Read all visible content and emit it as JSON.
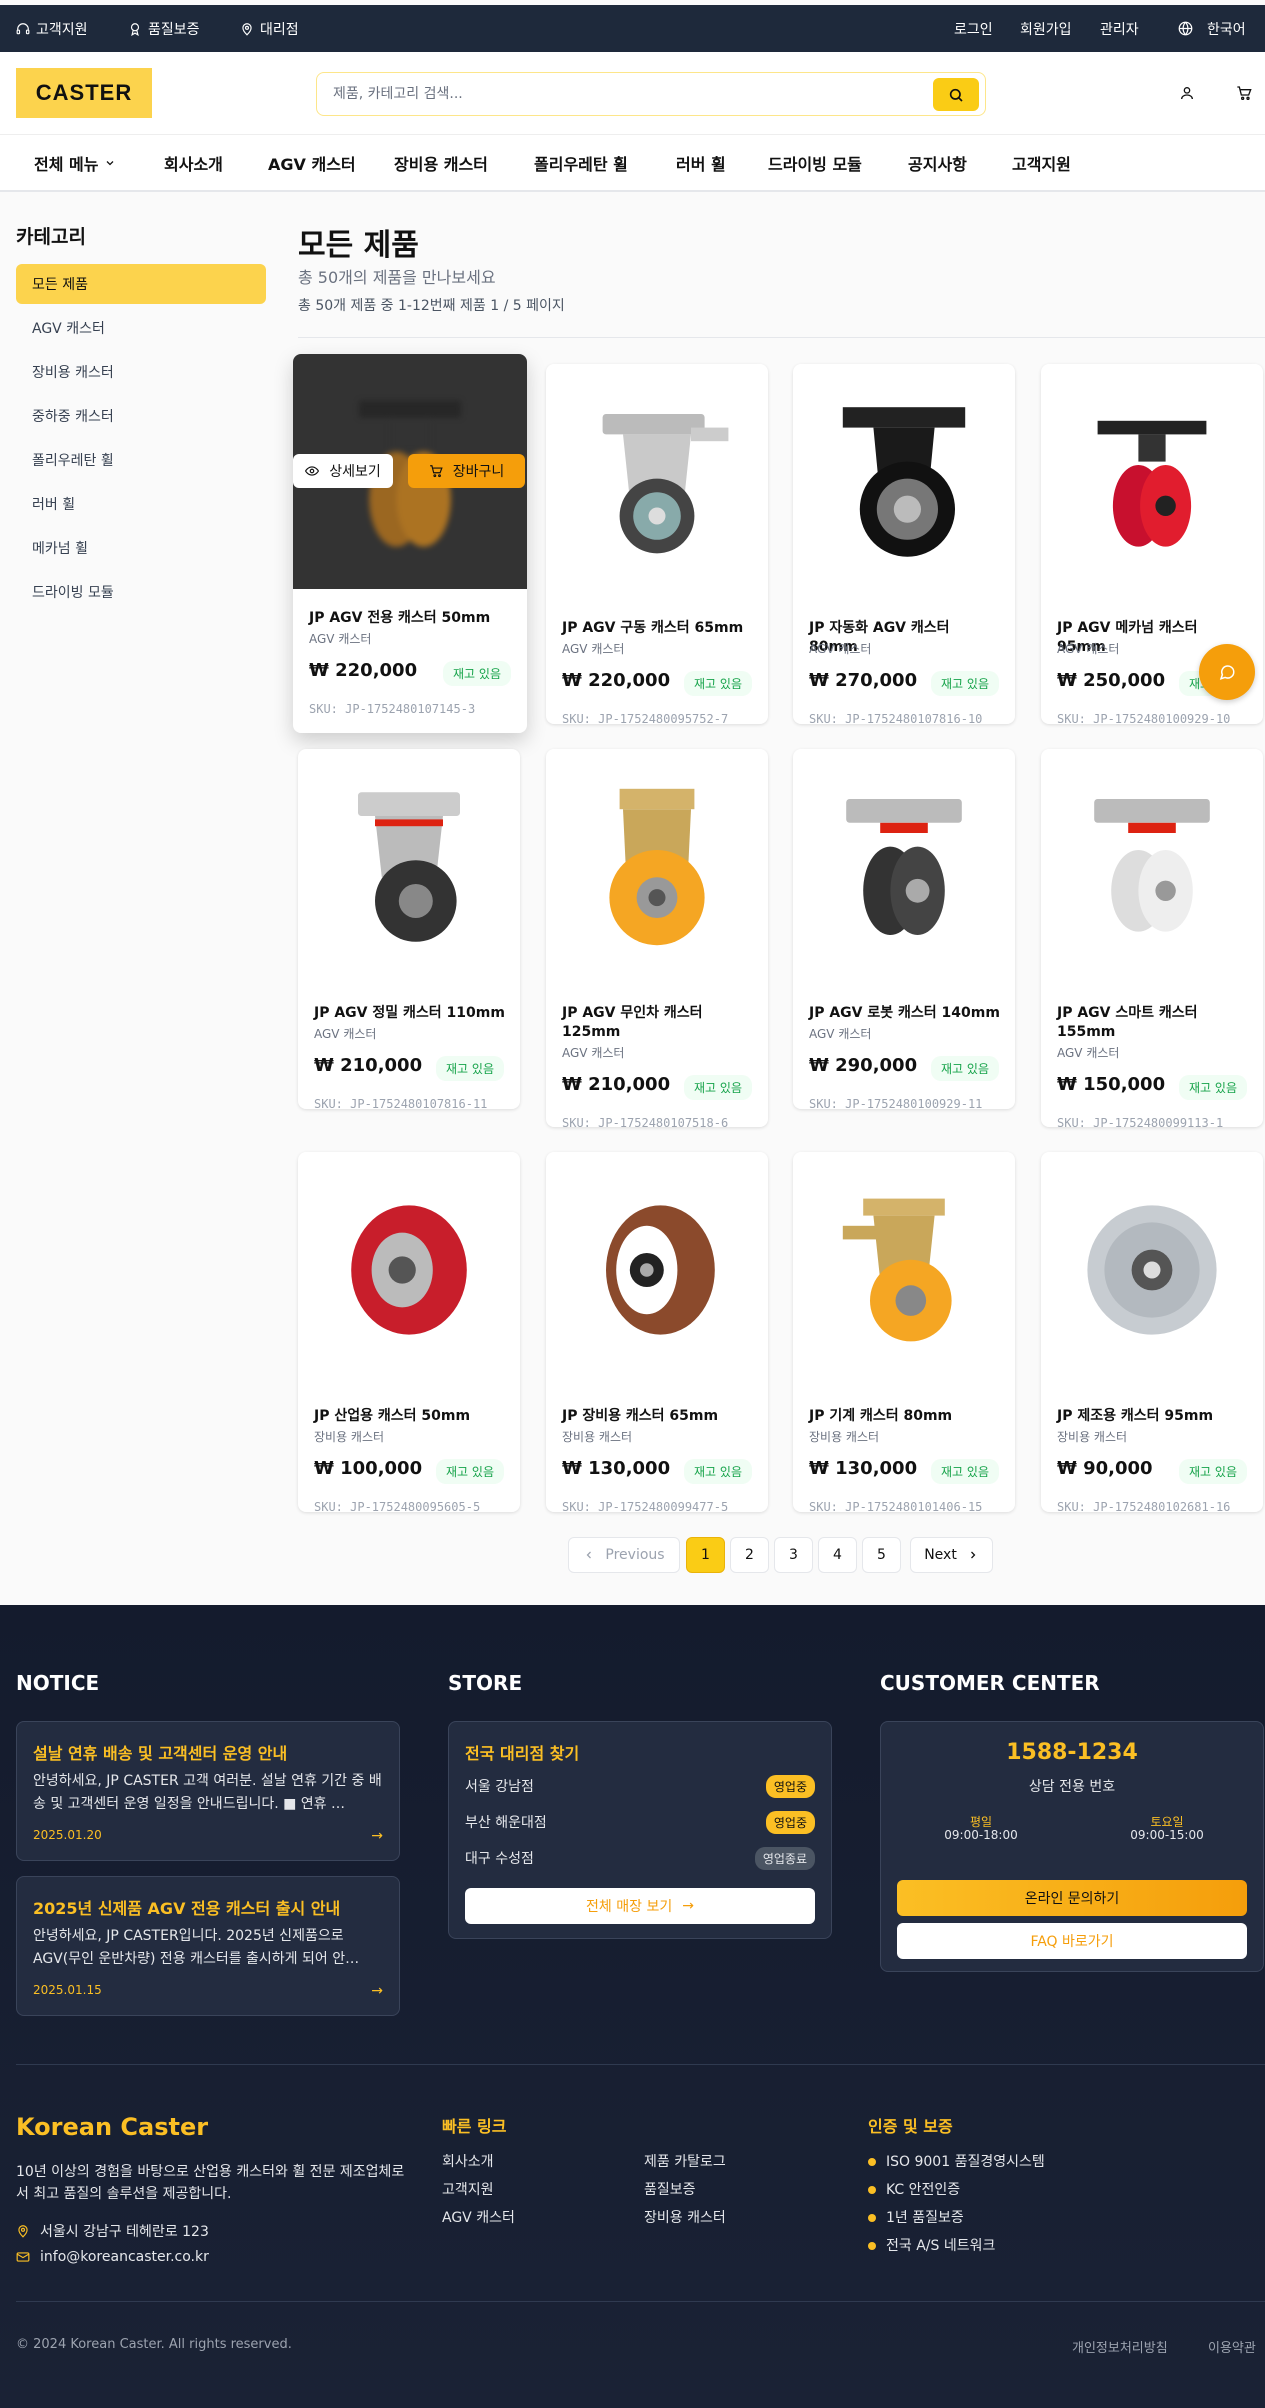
{
  "topbar": {
    "left": [
      "고객지원",
      "품질보증",
      "대리점"
    ],
    "right": [
      "로그인",
      "회원가입",
      "관리자"
    ],
    "language": "한국어"
  },
  "header": {
    "logo": "CASTER",
    "search_placeholder": "제품, 카테고리 검색..."
  },
  "nav": {
    "all_menu": "전체 메뉴",
    "items": [
      "회사소개",
      "AGV 캐스터",
      "장비용 캐스터",
      "폴리우레탄 휠",
      "러버 휠",
      "드라이빙 모듈",
      "공지사항",
      "고객지원"
    ]
  },
  "sidebar": {
    "title": "카테고리",
    "items": [
      "모든 제품",
      "AGV 캐스터",
      "장비용 캐스터",
      "중하중 캐스터",
      "폴리우레탄 휠",
      "러버 휠",
      "메카넘 휠",
      "드라이빙 모듈"
    ]
  },
  "page": {
    "title": "모든 제품",
    "subtitle": "총 50개의 제품을 만나보세요",
    "info": "총 50개 제품 중 1-12번째 제품    1 / 5 페이지"
  },
  "hover_actions": {
    "detail": "상세보기",
    "cart": "장바구니"
  },
  "products": [
    {
      "name": "JP AGV 전용 캐스터 50mm",
      "category": "AGV 캐스터",
      "price": "₩ 220,000",
      "stock": "재고 있음",
      "sku": "SKU: JP-1752480107145-3"
    },
    {
      "name": "JP AGV 구동 캐스터 65mm",
      "category": "AGV 캐스터",
      "price": "₩ 220,000",
      "stock": "재고 있음",
      "sku": "SKU: JP-1752480095752-7"
    },
    {
      "name": "JP 자동화 AGV 캐스터 80mm",
      "category": "AGV 캐스터",
      "price": "₩ 270,000",
      "stock": "재고 있음",
      "sku": "SKU: JP-1752480107816-10"
    },
    {
      "name": "JP AGV 메카넘 캐스터 95mm",
      "category": "AGV 캐스터",
      "price": "₩ 250,000",
      "stock": "재고 있음",
      "sku": "SKU: JP-1752480100929-10"
    },
    {
      "name": "JP AGV 정밀 캐스터 110mm",
      "category": "AGV 캐스터",
      "price": "₩ 210,000",
      "stock": "재고 있음",
      "sku": "SKU: JP-1752480107816-11"
    },
    {
      "name": "JP AGV 무인차 캐스터 125mm",
      "category": "AGV 캐스터",
      "price": "₩ 210,000",
      "stock": "재고 있음",
      "sku": "SKU: JP-1752480107518-6"
    },
    {
      "name": "JP AGV 로봇 캐스터 140mm",
      "category": "AGV 캐스터",
      "price": "₩ 290,000",
      "stock": "재고 있음",
      "sku": "SKU: JP-1752480100929-11"
    },
    {
      "name": "JP AGV 스마트 캐스터 155mm",
      "category": "AGV 캐스터",
      "price": "₩ 150,000",
      "stock": "재고 있음",
      "sku": "SKU: JP-1752480099113-1"
    },
    {
      "name": "JP 산업용 캐스터 50mm",
      "category": "장비용 캐스터",
      "price": "₩ 100,000",
      "stock": "재고 있음",
      "sku": "SKU: JP-1752480095605-5"
    },
    {
      "name": "JP 장비용 캐스터 65mm",
      "category": "장비용 캐스터",
      "price": "₩ 130,000",
      "stock": "재고 있음",
      "sku": "SKU: JP-1752480099477-5"
    },
    {
      "name": "JP 기계 캐스터 80mm",
      "category": "장비용 캐스터",
      "price": "₩ 130,000",
      "stock": "재고 있음",
      "sku": "SKU: JP-1752480101406-15"
    },
    {
      "name": "JP 제조용 캐스터 95mm",
      "category": "장비용 캐스터",
      "price": "₩ 90,000",
      "stock": "재고 있음",
      "sku": "SKU: JP-1752480102681-16"
    }
  ],
  "pagination": {
    "prev": "Previous",
    "pages": [
      "1",
      "2",
      "3",
      "4",
      "5"
    ],
    "next": "Next",
    "current": "1"
  },
  "footer": {
    "notice_title": "NOTICE",
    "notices": [
      {
        "title": "설날 연휴 배송 및 고객센터 운영 안내",
        "desc": "안녕하세요, JP CASTER 고객 여러분. 설날 연휴 기간 중 배송 및 고객센터 운영 일정을 안내드립니다. ■ 연휴 …",
        "date": "2025.01.20"
      },
      {
        "title": "2025년 신제품 AGV 전용 캐스터 출시 안내",
        "desc": "안녕하세요, JP CASTER입니다. 2025년 신제품으로 AGV(무인 운반차량) 전용 캐스터를 출시하게 되어 안…",
        "date": "2025.01.15"
      }
    ],
    "store_title": "STORE",
    "store_box_title": "전국 대리점 찾기",
    "stores": [
      {
        "name": "서울 강남점",
        "status": "영업중"
      },
      {
        "name": "부산 해운대점",
        "status": "영업중"
      },
      {
        "name": "대구 수성점",
        "status": "영업종료"
      }
    ],
    "store_button": "전체 매장 보기",
    "cc_title": "CUSTOMER CENTER",
    "phone": "1588-1234",
    "phone_label": "상담 전용 번호",
    "weekday_label": "평일",
    "weekday_hours": "09:00-18:00",
    "sat_label": "토요일",
    "sat_hours": "09:00-15:00",
    "inquiry_button": "온라인 문의하기",
    "faq_button": "FAQ 바로가기",
    "brand": "Korean Caster",
    "brand_desc": "10년 이상의 경험을 바탕으로 산업용 캐스터와 휠 전문 제조업체로서 최고 품질의 솔루션을 제공합니다.",
    "address": "서울시 강남구 테헤란로 123",
    "email": "info@koreancaster.co.kr",
    "quick_title": "빠른 링크",
    "quick_links": [
      "회사소개",
      "제품 카탈로그",
      "고객지원",
      "품질보증",
      "AGV 캐스터",
      "장비용 캐스터"
    ],
    "cert_title": "인증 및 보증",
    "certs": [
      "ISO 9001 품질경영시스템",
      "KC 안전인증",
      "1년 품질보증",
      "전국 A/S 네트워크"
    ],
    "copyright": "© 2024 Korean Caster. All rights reserved.",
    "privacy": "개인정보처리방침",
    "terms": "이용약관"
  }
}
